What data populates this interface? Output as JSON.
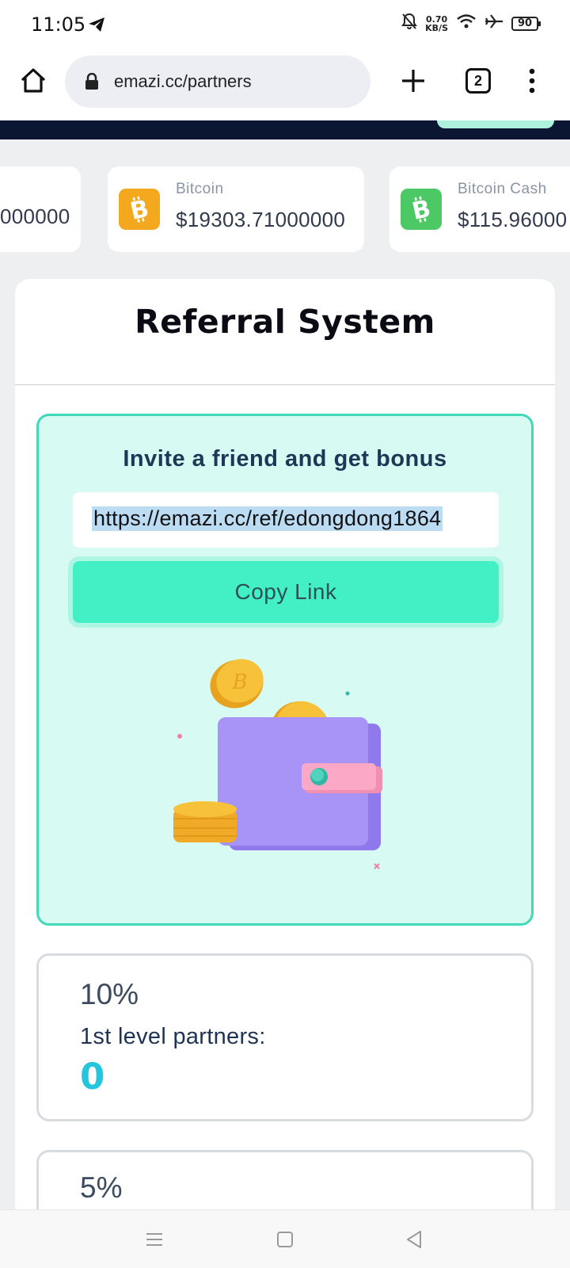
{
  "status_bar": {
    "time": "11:05",
    "net_speed_value": "0.70",
    "net_speed_unit": "KB/S",
    "battery": "90"
  },
  "browser": {
    "url": "emazi.cc/partners",
    "tab_count": "2"
  },
  "ticker": [
    {
      "name": "",
      "price": "000000",
      "icon": "coin-icon",
      "color": "#f3a81d"
    },
    {
      "name": "Bitcoin",
      "price": "$19303.71000000",
      "icon": "bitcoin-icon",
      "color": "#f3a81d"
    },
    {
      "name": "Bitcoin Cash",
      "price": "$115.96000",
      "icon": "bitcoin-cash-icon",
      "color": "#4cc964"
    }
  ],
  "referral": {
    "title": "Referral System",
    "invite_title": "Invite a friend and get bonus",
    "link": "https://emazi.cc/ref/edongdong1864",
    "copy_label": "Copy Link"
  },
  "levels": [
    {
      "percent": "10%",
      "label": "1st level partners:",
      "count": "0"
    },
    {
      "percent": "5%",
      "label": "",
      "count": ""
    }
  ],
  "colors": {
    "accent": "#43efc5",
    "invite_bg": "#d7fbf3",
    "header_dark": "#0b1633",
    "count": "#23c6dd"
  }
}
